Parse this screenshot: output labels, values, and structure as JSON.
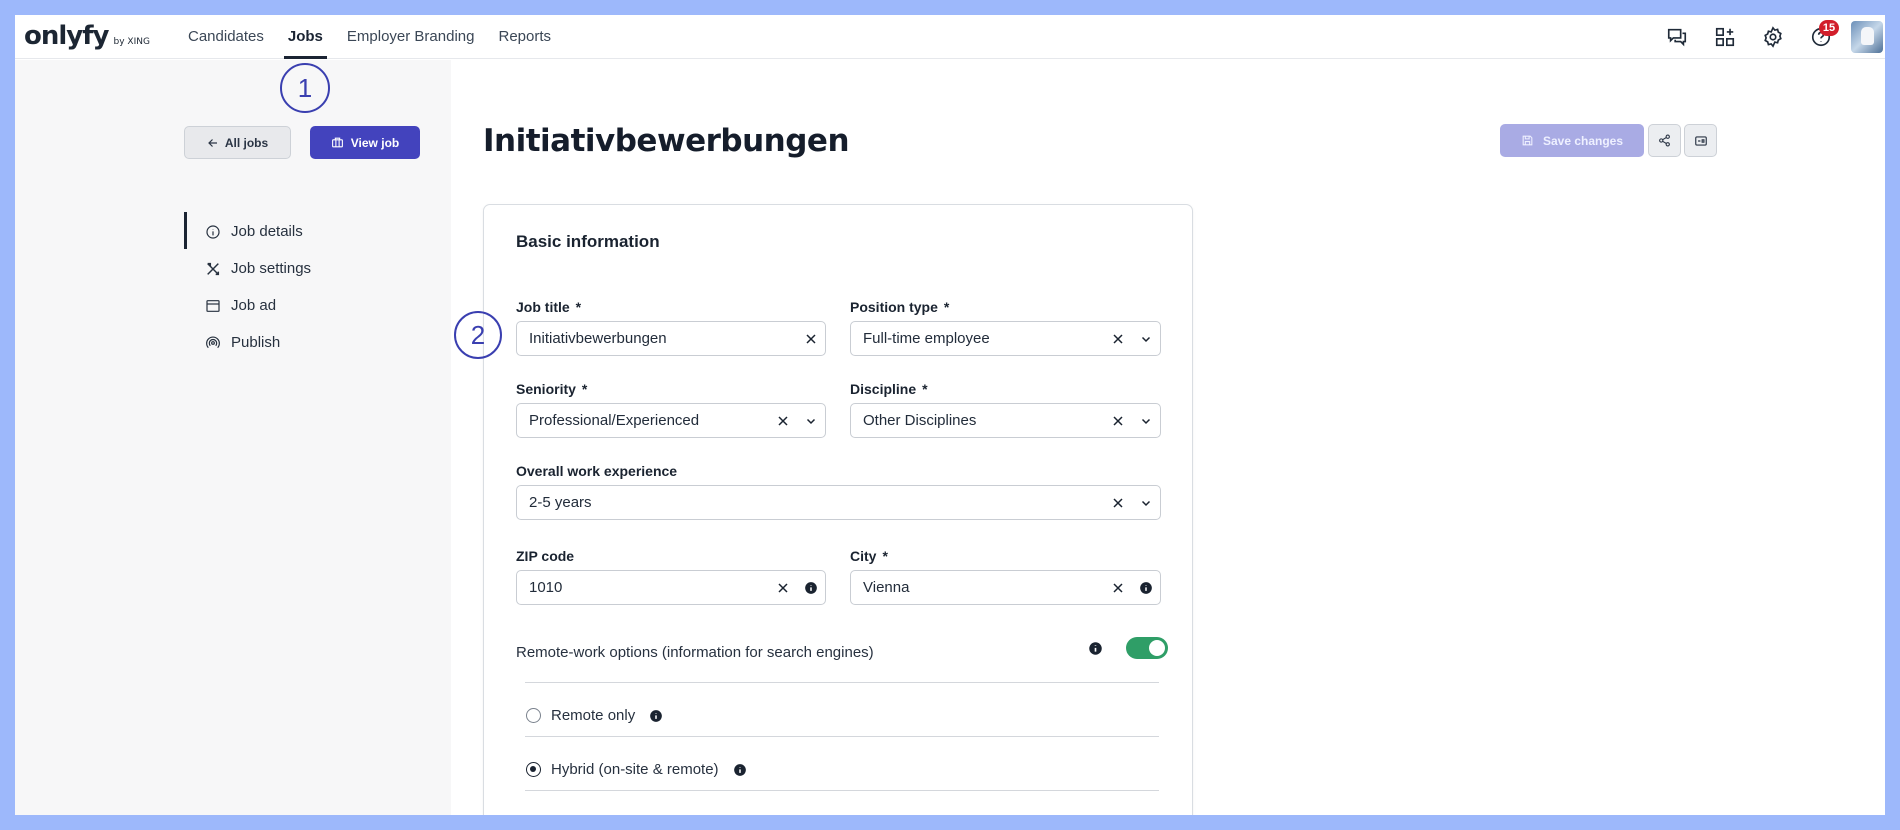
{
  "brand": {
    "logo": "onlyfy",
    "sub": "by XING"
  },
  "nav": [
    {
      "label": "Candidates"
    },
    {
      "label": "Jobs",
      "active": true
    },
    {
      "label": "Employer Branding"
    },
    {
      "label": "Reports"
    }
  ],
  "top_icons": {
    "notifications_count": "15",
    "icons": [
      "chat-icon",
      "apps-add-icon",
      "settings-icon",
      "help-icon",
      "user-avatar"
    ]
  },
  "annotations": {
    "marker1": "1",
    "marker2": "2"
  },
  "actions": {
    "all_jobs": "All jobs",
    "view_job": "View job",
    "save_changes": "Save changes"
  },
  "sidebar": {
    "items": [
      {
        "label": "Job details",
        "icon": "info-icon",
        "active": true
      },
      {
        "label": "Job settings",
        "icon": "tools-icon"
      },
      {
        "label": "Job ad",
        "icon": "browser-window-icon"
      },
      {
        "label": "Publish",
        "icon": "broadcast-icon"
      }
    ]
  },
  "page": {
    "title": "Initiativbewerbungen"
  },
  "form": {
    "section_title": "Basic information",
    "job_title": {
      "label": "Job title",
      "required": "*",
      "value": "Initiativbewerbungen"
    },
    "position_type": {
      "label": "Position type",
      "required": "*",
      "value": "Full-time employee"
    },
    "seniority": {
      "label": "Seniority",
      "required": "*",
      "value": "Professional/Experienced"
    },
    "discipline": {
      "label": "Discipline",
      "required": "*",
      "value": "Other Disciplines"
    },
    "experience": {
      "label": "Overall work experience",
      "value": "2-5 years"
    },
    "zip": {
      "label": "ZIP code",
      "value": "1010"
    },
    "city": {
      "label": "City",
      "required": "*",
      "value": "Vienna"
    },
    "remote": {
      "label": "Remote-work options (information for search engines)",
      "enabled": true,
      "options": [
        {
          "label": "Remote only",
          "checked": false
        },
        {
          "label": "Hybrid (on-site & remote)",
          "checked": true
        }
      ]
    }
  },
  "colors": {
    "primary": "#4343bd",
    "save_disabled": "#a9abe4",
    "toggle_on": "#2f9e67",
    "badge": "#d21e2b",
    "annotation": "#3a3fb0",
    "frame": "#9db8fb"
  }
}
